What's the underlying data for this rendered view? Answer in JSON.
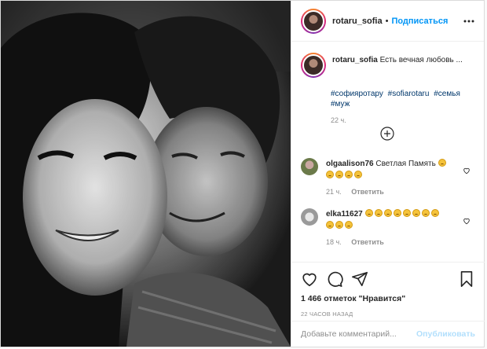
{
  "header": {
    "username": "rotaru_sofia",
    "dot": "•",
    "follow_label": "Подписаться"
  },
  "caption": {
    "username": "rotaru_sofia",
    "text": "Есть вечная любовь ...",
    "tags": [
      "#софияротару",
      "#sofiarotaru",
      "#семья",
      "#муж"
    ],
    "time": "22 ч."
  },
  "comments": [
    {
      "username": "olgaalison76",
      "text": "Светлая Память",
      "emoji_count": 5,
      "time": "21 ч.",
      "reply_label": "Ответить"
    },
    {
      "username": "elka11627",
      "text": "",
      "emoji_count": 11,
      "time": "18 ч.",
      "reply_label": "Ответить"
    }
  ],
  "likes_text": "1 466 отметок \"Нравится\"",
  "posted_ago": "22 ЧАСОВ НАЗАД",
  "add_comment": {
    "placeholder": "Добавьте комментарий...",
    "publish_label": "Опубликовать"
  },
  "icons": {
    "more": "more-icon",
    "load_more": "plus-circle-icon",
    "like": "heart-icon",
    "comment": "comment-icon",
    "share": "paper-plane-icon",
    "save": "bookmark-icon"
  },
  "colors": {
    "accent": "#0095f6",
    "link": "#00376b",
    "muted": "#8e8e8e",
    "publish_disabled": "#b2dffc",
    "border": "#dbdbdb"
  }
}
